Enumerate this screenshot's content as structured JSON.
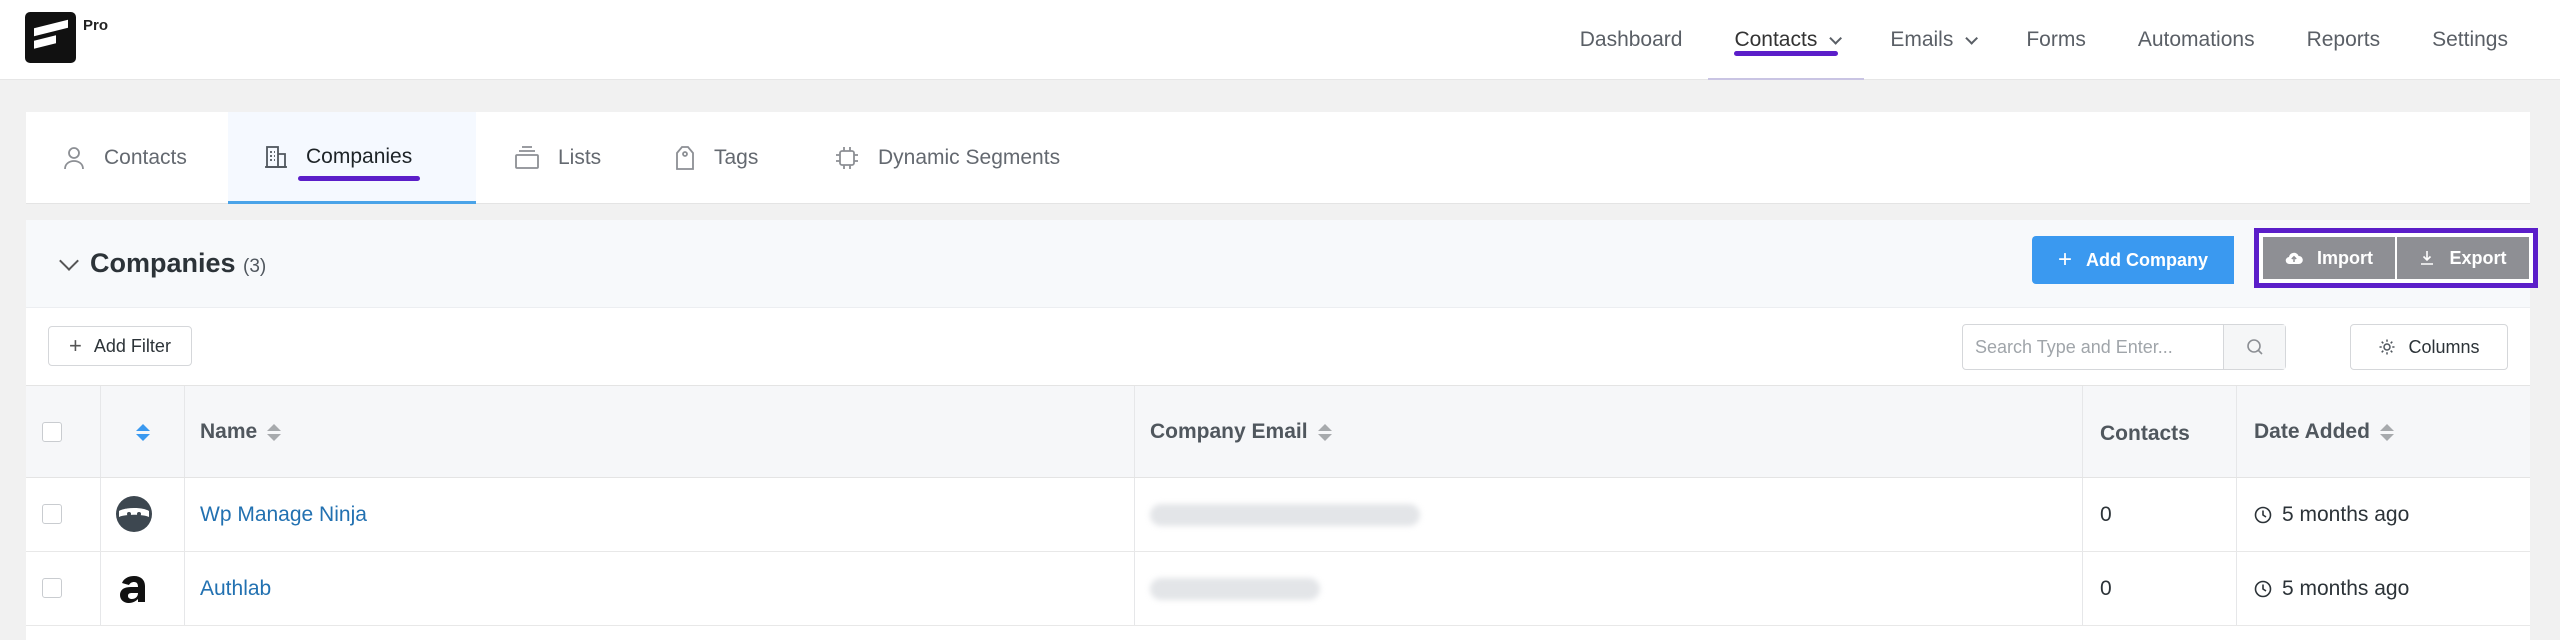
{
  "app": {
    "badge": "Pro"
  },
  "nav": {
    "items": [
      {
        "label": "Dashboard",
        "active": false,
        "dropdown": false
      },
      {
        "label": "Contacts",
        "active": true,
        "dropdown": true
      },
      {
        "label": "Emails",
        "active": false,
        "dropdown": true
      },
      {
        "label": "Forms",
        "active": false,
        "dropdown": false
      },
      {
        "label": "Automations",
        "active": false,
        "dropdown": false
      },
      {
        "label": "Reports",
        "active": false,
        "dropdown": false
      },
      {
        "label": "Settings",
        "active": false,
        "dropdown": false
      }
    ]
  },
  "tabs": [
    {
      "label": "Contacts",
      "icon": "user-icon"
    },
    {
      "label": "Companies",
      "icon": "building-icon",
      "active": true
    },
    {
      "label": "Lists",
      "icon": "stack-icon"
    },
    {
      "label": "Tags",
      "icon": "tag-icon"
    },
    {
      "label": "Dynamic Segments",
      "icon": "chip-icon"
    }
  ],
  "panel": {
    "title": "Companies",
    "count": "(3)",
    "add_company_label": "Add Company",
    "import_label": "Import",
    "export_label": "Export",
    "add_filter_label": "Add Filter",
    "search_placeholder": "Search Type and Enter...",
    "columns_label": "Columns"
  },
  "table": {
    "headers": {
      "name": "Name",
      "email": "Company Email",
      "contacts": "Contacts",
      "date_added": "Date Added"
    },
    "rows": [
      {
        "name": "Wp Manage Ninja",
        "contacts": "0",
        "date_added": "5 months ago",
        "avatar": "ninja-logo-icon"
      },
      {
        "name": "Authlab",
        "contacts": "0",
        "date_added": "5 months ago",
        "avatar": "authlab-logo-icon"
      }
    ]
  },
  "colors": {
    "accent": "#3a99f0",
    "highlight": "#5b1ec9",
    "link": "#2271b1",
    "button_gray": "#8e8f94"
  }
}
